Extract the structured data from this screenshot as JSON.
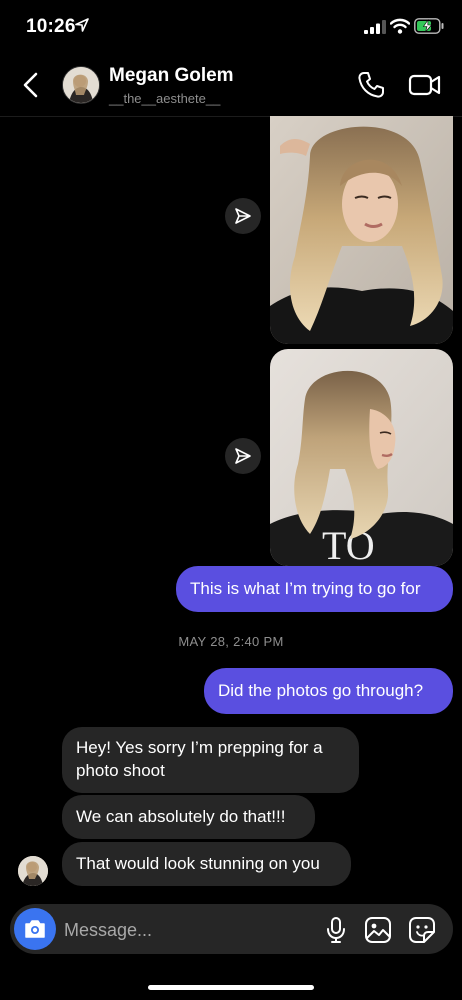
{
  "status_bar": {
    "time": "10:26"
  },
  "header": {
    "name": "Megan Golem",
    "handle": "__the__aesthete__"
  },
  "messages": [
    {
      "from": "me",
      "text": "This is what I’m trying to go for"
    },
    {
      "from": "me",
      "text": "Did the photos go through?"
    },
    {
      "from": "them",
      "text": "Hey! Yes sorry I’m prepping for a photo shoot"
    },
    {
      "from": "them",
      "text": "We can absolutely do that!!!"
    },
    {
      "from": "them",
      "text": "That would look stunning on you"
    }
  ],
  "timestamp": "MAY 28, 2:40 PM",
  "composer": {
    "placeholder": "Message..."
  },
  "colors": {
    "outgoing_bubble": "#5a4fe0",
    "incoming_bubble": "#262626",
    "camera_button": "#3a74f0",
    "background": "#000000"
  },
  "icons": [
    "location-arrow-icon",
    "signal-icon",
    "wifi-icon",
    "battery-charging-icon",
    "back-chevron-icon",
    "phone-icon",
    "video-camera-icon",
    "share-send-icon",
    "camera-icon",
    "microphone-icon",
    "gallery-icon",
    "sticker-icon"
  ]
}
